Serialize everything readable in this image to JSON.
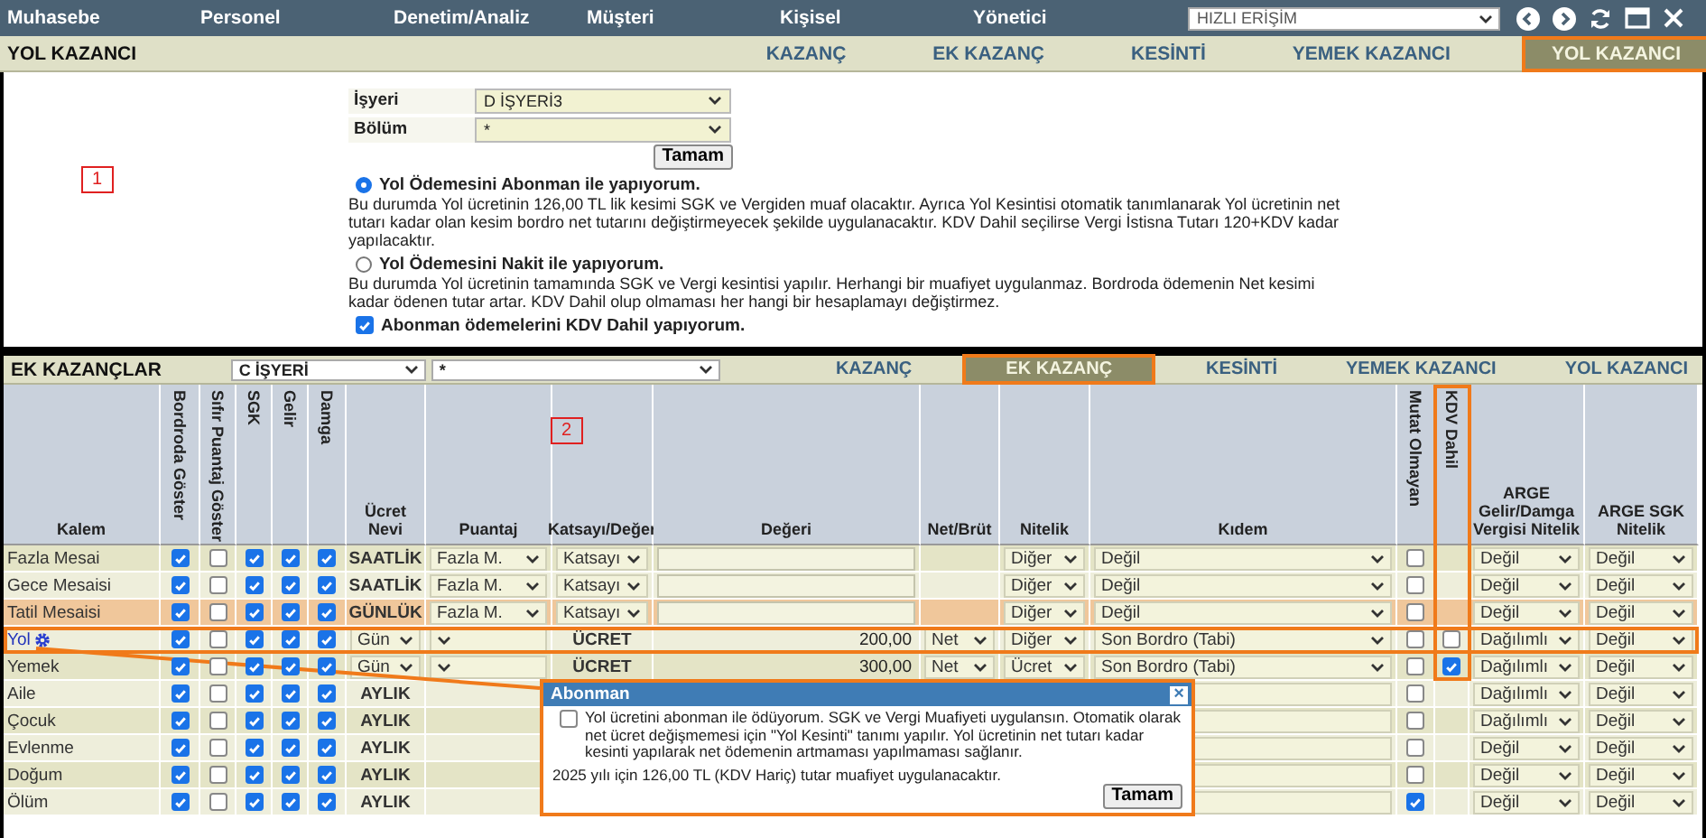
{
  "nav": {
    "items": [
      "Muhasebe",
      "Personel",
      "Denetim/Analiz",
      "Müşteri",
      "Kişisel",
      "Yönetici"
    ],
    "quick_access": "HIZLI ERİŞİM"
  },
  "top_screen": {
    "title": "YOL KAZANCI",
    "tabs": [
      {
        "label": "KAZANÇ",
        "selected": false
      },
      {
        "label": "EK KAZANÇ",
        "selected": false
      },
      {
        "label": "KESİNTİ",
        "selected": false
      },
      {
        "label": "YEMEK KAZANCI",
        "selected": false
      },
      {
        "label": "YOL KAZANCI",
        "selected": true
      }
    ],
    "annotation": "1",
    "fields": [
      {
        "label": "İşyeri",
        "value": "D İŞYERİ3"
      },
      {
        "label": "Bölüm",
        "value": "*"
      }
    ],
    "ok_button": "Tamam",
    "options": [
      {
        "label": "Yol Ödemesini Abonman ile yapıyorum.",
        "selected": true,
        "description": "Bu durumda Yol ücretinin 126,00 TL lik kesimi SGK ve Vergiden muaf olacaktır. Ayrıca Yol Kesintisi otomatik tanımlanarak Yol ücretinin net tutarı kadar olan kesim bordro net tutarını değiştirmeyecek şekilde uygulanacaktır. KDV Dahil seçilirse Vergi İstisna Tutarı 120+KDV kadar yapılacaktır."
      },
      {
        "label": "Yol Ödemesini Nakit ile yapıyorum.",
        "selected": false,
        "description": "Bu durumda Yol ücretinin tamamında SGK ve Vergi kesintisi yapılır. Herhangi bir muafiyet uygulanmaz. Bordroda ödemenin Net kesimi kadar ödenen tutar artar. KDV Dahil olup olmaması her hangi bir hesaplamayı değiştirmez."
      }
    ],
    "kdv_option": {
      "label": "Abonman ödemelerini KDV Dahil yapıyorum.",
      "checked": true
    }
  },
  "bottom_screen": {
    "title": "EK KAZANÇLAR",
    "company": "C İŞYERİ",
    "section": "*",
    "tabs": [
      {
        "label": "KAZANÇ",
        "selected": false
      },
      {
        "label": "EK KAZANÇ",
        "selected": true
      },
      {
        "label": "KESİNTİ",
        "selected": false
      },
      {
        "label": "YEMEK KAZANCI",
        "selected": false
      },
      {
        "label": "YOL KAZANCI",
        "selected": false
      }
    ],
    "annotation": "2",
    "columns": [
      {
        "label": "Kalem",
        "vertical": false
      },
      {
        "label": "Bordroda Göster",
        "vertical": true
      },
      {
        "label": "Sıfır Puantaj Göster",
        "vertical": true
      },
      {
        "label": "SGK",
        "vertical": true
      },
      {
        "label": "Gelir",
        "vertical": true
      },
      {
        "label": "Damga",
        "vertical": true
      },
      {
        "label": "Ücret Nevi",
        "vertical": false
      },
      {
        "label": "Puantaj",
        "vertical": false
      },
      {
        "label": "Katsayı/Değer",
        "vertical": false
      },
      {
        "label": "Değeri",
        "vertical": false
      },
      {
        "label": "Net/Brüt",
        "vertical": false
      },
      {
        "label": "Nitelik",
        "vertical": false
      },
      {
        "label": "Kıdem",
        "vertical": false
      },
      {
        "label": "Mutat Olmayan",
        "vertical": true
      },
      {
        "label": "KDV Dahil",
        "vertical": true,
        "annotated": true
      },
      {
        "label": "ARGE Gelir/Damga Vergisi Nitelik",
        "vertical": false
      },
      {
        "label": "ARGE SGK Nitelik",
        "vertical": false
      }
    ],
    "rows": [
      {
        "name": "Fazla Mesai",
        "kind": "plain",
        "selected": false,
        "annotated": false,
        "checks": [
          true,
          false,
          true,
          true,
          true
        ],
        "ucret_nevi": {
          "kind": "text",
          "value": "SAATLİK"
        },
        "puantaj": {
          "kind": "select",
          "value": "Fazla M."
        },
        "katsayi": {
          "kind": "select",
          "value": "Katsayı"
        },
        "degeri": {
          "kind": "input"
        },
        "nitelik": {
          "kind": "select",
          "value": "Diğer"
        },
        "kidem": {
          "kind": "select",
          "value": "Değil"
        },
        "mutat": false,
        "arge_gelir": "Değil",
        "arge_sgk": "Değil"
      },
      {
        "name": "Gece Mesaisi",
        "kind": "plain",
        "selected": false,
        "annotated": false,
        "checks": [
          true,
          false,
          true,
          true,
          true
        ],
        "ucret_nevi": {
          "kind": "text",
          "value": "SAATLİK"
        },
        "puantaj": {
          "kind": "select",
          "value": "Fazla M."
        },
        "katsayi": {
          "kind": "select",
          "value": "Katsayı"
        },
        "degeri": {
          "kind": "input"
        },
        "nitelik": {
          "kind": "select",
          "value": "Diğer"
        },
        "kidem": {
          "kind": "select",
          "value": "Değil"
        },
        "mutat": false,
        "arge_gelir": "Değil",
        "arge_sgk": "Değil"
      },
      {
        "name": "Tatil Mesaisi",
        "kind": "plain",
        "selected": true,
        "annotated": false,
        "checks": [
          true,
          false,
          true,
          true,
          true
        ],
        "ucret_nevi": {
          "kind": "text",
          "value": "GÜNLÜK"
        },
        "puantaj": {
          "kind": "select",
          "value": "Fazla M."
        },
        "katsayi": {
          "kind": "select",
          "value": "Katsayı"
        },
        "degeri": {
          "kind": "input"
        },
        "nitelik": {
          "kind": "select",
          "value": "Diğer"
        },
        "kidem": {
          "kind": "select",
          "value": "Değil"
        },
        "mutat": false,
        "arge_gelir": "Değil",
        "arge_sgk": "Değil"
      },
      {
        "name": "Yol",
        "kind": "link",
        "selected": false,
        "annotated": true,
        "checks": [
          true,
          false,
          true,
          true,
          true
        ],
        "ucret_nevi": {
          "kind": "select",
          "value": "Gün"
        },
        "puantaj": {
          "kind": "select"
        },
        "katsayi": {
          "kind": "text",
          "value": "ÜCRET"
        },
        "degeri": {
          "kind": "text",
          "value": "200,00"
        },
        "net_brut": {
          "kind": "select",
          "value": "Net"
        },
        "nitelik": {
          "kind": "select",
          "value": "Diğer"
        },
        "kidem": {
          "kind": "select",
          "value": "Son Bordro (Tabi)"
        },
        "mutat": false,
        "kdv": false,
        "arge_gelir": "Dağılımlı",
        "arge_sgk": "Değil"
      },
      {
        "name": "Yemek",
        "kind": "plain",
        "selected": false,
        "annotated": false,
        "checks": [
          true,
          false,
          true,
          true,
          true
        ],
        "ucret_nevi": {
          "kind": "select",
          "value": "Gün"
        },
        "puantaj": {
          "kind": "select"
        },
        "katsayi": {
          "kind": "text",
          "value": "ÜCRET"
        },
        "degeri": {
          "kind": "text",
          "value": "300,00"
        },
        "net_brut": {
          "kind": "select",
          "value": "Net"
        },
        "nitelik": {
          "kind": "select",
          "value": "Ücret"
        },
        "kidem": {
          "kind": "select",
          "value": "Son Bordro (Tabi)"
        },
        "mutat": false,
        "kdv": true,
        "arge_gelir": "Dağılımlı",
        "arge_sgk": "Değil"
      },
      {
        "name": "Aile",
        "kind": "plain",
        "selected": false,
        "annotated": false,
        "checks": [
          true,
          false,
          true,
          true,
          true
        ],
        "ucret_nevi": {
          "kind": "text",
          "value": "AYLIK"
        },
        "kidem": {
          "kind": "select"
        },
        "mutat": false,
        "arge_gelir": "Dağılımlı",
        "arge_sgk": "Değil"
      },
      {
        "name": "Çocuk",
        "kind": "plain",
        "selected": false,
        "annotated": false,
        "checks": [
          true,
          false,
          true,
          true,
          true
        ],
        "ucret_nevi": {
          "kind": "text",
          "value": "AYLIK"
        },
        "kidem": {
          "kind": "select"
        },
        "mutat": false,
        "arge_gelir": "Dağılımlı",
        "arge_sgk": "Değil"
      },
      {
        "name": "Evlenme",
        "kind": "plain",
        "selected": false,
        "annotated": false,
        "checks": [
          true,
          false,
          true,
          true,
          true
        ],
        "ucret_nevi": {
          "kind": "text",
          "value": "AYLIK"
        },
        "kidem": {
          "kind": "select"
        },
        "mutat": false,
        "arge_gelir": "Değil",
        "arge_sgk": "Değil"
      },
      {
        "name": "Doğum",
        "kind": "plain",
        "selected": false,
        "annotated": false,
        "checks": [
          true,
          false,
          true,
          true,
          true
        ],
        "ucret_nevi": {
          "kind": "text",
          "value": "AYLIK"
        },
        "kidem": {
          "kind": "select"
        },
        "mutat": false,
        "arge_gelir": "Değil",
        "arge_sgk": "Değil"
      },
      {
        "name": "Ölüm",
        "kind": "plain",
        "selected": false,
        "annotated": false,
        "checks": [
          true,
          false,
          true,
          true,
          true
        ],
        "ucret_nevi": {
          "kind": "text",
          "value": "AYLIK"
        },
        "kidem": {
          "kind": "select"
        },
        "mutat": true,
        "arge_gelir": "Değil",
        "arge_sgk": "Değil"
      }
    ],
    "dialog": {
      "title": "Abonman",
      "close": "×",
      "option": {
        "checked": false,
        "label": "Yol ücretini abonman ile ödüyorum. SGK ve Vergi Muafiyeti uygulansın. Otomatik olarak net ücret değişmemesi için \"Yol Kesinti\" tanımı yapılır. Yol ücretinin net tutarı kadar kesinti yapılarak net ödemenin artmaması yapılmaması sağlanır."
      },
      "note": "2025 yılı için 126,00 TL (KDV Hariç) tutar muafiyet uygulanacaktır.",
      "ok_button": "Tamam"
    }
  }
}
